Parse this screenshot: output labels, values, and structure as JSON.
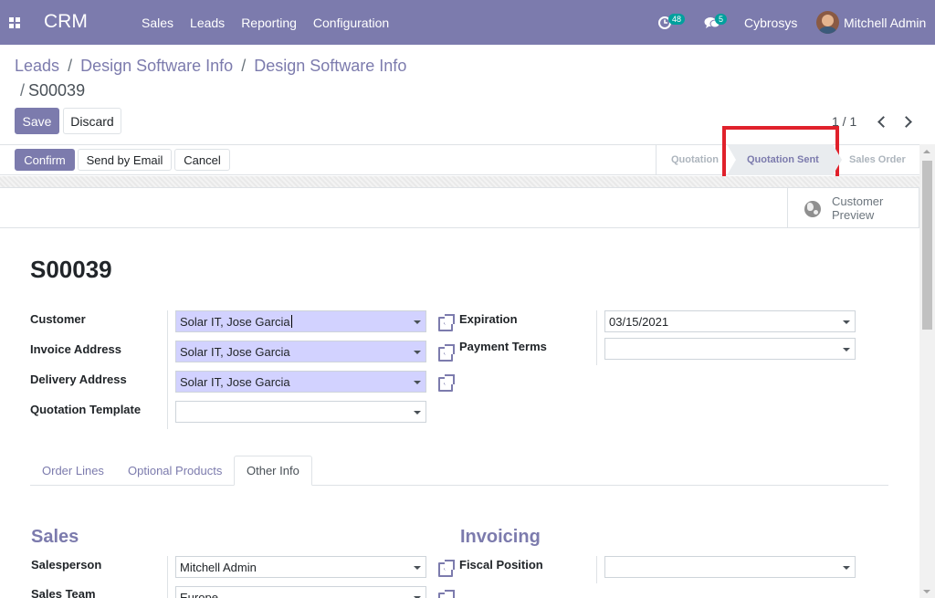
{
  "navbar": {
    "brand": "CRM",
    "menu": [
      "Sales",
      "Leads",
      "Reporting",
      "Configuration"
    ],
    "activity_count": "48",
    "message_count": "5",
    "company": "Cybrosys",
    "user": "Mitchell Admin"
  },
  "breadcrumb": {
    "items": [
      "Leads",
      "Design Software Info",
      "Design Software Info"
    ],
    "current": "S00039",
    "separator": "/"
  },
  "control": {
    "save_label": "Save",
    "discard_label": "Discard",
    "pager": "1 / 1"
  },
  "header": {
    "confirm_label": "Confirm",
    "send_email_label": "Send by Email",
    "cancel_label": "Cancel",
    "status_steps": [
      "Quotation",
      "Quotation Sent",
      "Sales Order"
    ],
    "active_step": "Quotation Sent"
  },
  "smart_button": {
    "line1": "Customer",
    "line2": "Preview"
  },
  "record": {
    "title": "S00039"
  },
  "fields": {
    "customer_label": "Customer",
    "customer_value": "Solar IT, Jose Garcia",
    "invoice_address_label": "Invoice Address",
    "invoice_address_value": "Solar IT, Jose Garcia",
    "delivery_address_label": "Delivery Address",
    "delivery_address_value": "Solar IT, Jose Garcia",
    "quotation_template_label": "Quotation Template",
    "quotation_template_value": "",
    "expiration_label": "Expiration",
    "expiration_value": "03/15/2021",
    "payment_terms_label": "Payment Terms",
    "payment_terms_value": ""
  },
  "tabs": [
    "Order Lines",
    "Optional Products",
    "Other Info"
  ],
  "active_tab": "Other Info",
  "other_info": {
    "sales_title": "Sales",
    "salesperson_label": "Salesperson",
    "salesperson_value": "Mitchell Admin",
    "sales_team_label": "Sales Team",
    "sales_team_value": "Europe",
    "invoicing_title": "Invoicing",
    "fiscal_position_label": "Fiscal Position",
    "fiscal_position_value": ""
  },
  "colors": {
    "primary": "#7c7bad",
    "required_field": "#d2d2ff",
    "highlight": "#e0212b",
    "badge": "#00a09d"
  }
}
